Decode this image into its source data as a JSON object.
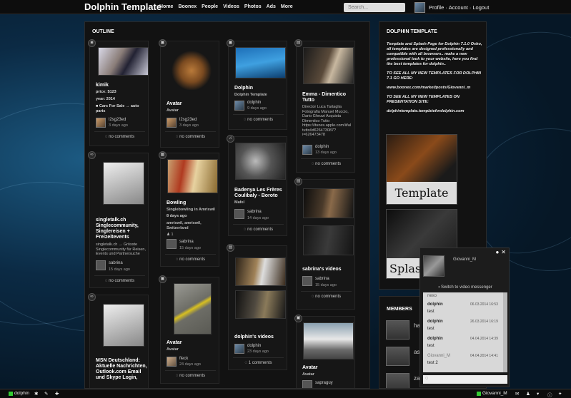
{
  "header": {
    "logo": "Dolphin Template",
    "nav": [
      "Home",
      "Boonex",
      "People",
      "Videos",
      "Photos",
      "Ads",
      "More"
    ],
    "search_placeholder": "Search...",
    "user_menu": [
      "Profile",
      "·",
      "Account",
      "·",
      "Logout"
    ]
  },
  "outline": {
    "title": "OUTLINE",
    "col1": [
      {
        "icon": "camera-icon",
        "title": "kimik",
        "price": "price: $123",
        "year": "year: 2014",
        "category": "Cars For Sale → auto parts",
        "user": "l2sg23ed",
        "date": "3 days ago",
        "comments": "no comments"
      },
      {
        "icon": "link-icon",
        "title": "singletalk.ch Singlecommunity, Singlereisen + Freizeitevents",
        "desc": "singletalk.ch → Grösste Singlecommunity für Reisen, Events und Partnersuche",
        "user": "sabrina",
        "date": "15 days ago",
        "comments": "no comments"
      },
      {
        "icon": "link-icon",
        "title": "MSN Deutschland: Aktuelle Nachrichten, Outlook.com Email und Skype Login,",
        "user": "",
        "date": "",
        "comments": ""
      }
    ],
    "col2": [
      {
        "icon": "image-icon",
        "title": "Avatar",
        "sub": "Avatar",
        "user": "l2sg23ed",
        "date": "3 days ago",
        "comments": "no comments"
      },
      {
        "icon": "calendar-icon",
        "title": "Bowling",
        "sub": "Singlebowling in Amriswil",
        "when": "8 days ago",
        "place": "amriswil, amriswil, Switzerland",
        "count": "1",
        "user": "sabrina",
        "date": "15 days ago",
        "comments": "no comments"
      },
      {
        "icon": "image-icon",
        "title": "Avatar",
        "sub": "Avatar",
        "user": "fleck",
        "date": "24 days ago",
        "comments": "no comments"
      }
    ],
    "col3": [
      {
        "icon": "image-icon",
        "title": "Dolphin",
        "sub": "Dolphin Template",
        "user": "dolphin",
        "date": "9 days ago",
        "comments": "no comments"
      },
      {
        "icon": "music-icon",
        "title": "Badenya Les Frères Coulibaly - Boroto",
        "sub": "Mafel",
        "user": "sabrina",
        "date": "14 days ago",
        "comments": "no comments"
      },
      {
        "icon": "film-icon",
        "title": "dolphin's videos",
        "user": "dolphin",
        "date": "23 days ago",
        "comments": "1 comments"
      }
    ],
    "col4": [
      {
        "icon": "film-icon",
        "title": "Emma - Dimentico Tutto",
        "desc": "Director Luca Tartaglia Fotografia Manuel Muccio, Dario Ghezzi Acquista Dimentico Tutto https://itunes.apple.com/it/al tutto/id626473087? i=626473478",
        "user": "dolphin",
        "date": "13 days ago",
        "comments": "no comments"
      },
      {
        "icon": "film-icon",
        "title": "sabrina's videos",
        "user": "sabrina",
        "date": "15 days ago",
        "comments": "no comments"
      },
      {
        "icon": "image-icon",
        "title": "Avatar",
        "sub": "Avatar",
        "user": "sapraguy",
        "date": "",
        "comments": ""
      }
    ]
  },
  "right": {
    "title": "DOLPHIN TEMPLATE",
    "text1": "Template and Splash Page for Dolphin 7.1.0 Osho, all templates are designed professionally and compatible with all browsers.. make a new professional look to your website, here you find the best templates for dolphin..",
    "text2": "TO SEE ALL MY NEW TEMPLATES FOR DOLPHIN 7.1 GO HERE:",
    "link1": "www.boonex.com/market/posts/Giovanni_m",
    "text3": "TO SEE ALL MY NEW TEMPLATES ON PRESENTATION SITE:",
    "link2": "dolphintemplate.templatefordolphin.com",
    "img_label1": "Template",
    "img_label2": "Splas",
    "members_title": "MEMBERS",
    "member_names": [
      "ha",
      "asl",
      "zai"
    ]
  },
  "chat": {
    "user": "Giovanni_M",
    "switch": "Switch to video messenger",
    "messages": [
      {
        "name": "nexo",
        "date": "",
        "text": ""
      },
      {
        "name": "dolphin",
        "date": "06.03.2014 16:53",
        "text": "test"
      },
      {
        "name": "dolphin",
        "date": "26.03.2014 16:19",
        "text": "test"
      },
      {
        "name": "dolphin",
        "date": "04.04.2014 14:39",
        "text": "test"
      },
      {
        "name": "Giovanni_M",
        "date": "04.04.2014 14:41",
        "text": "test 2"
      }
    ]
  },
  "bottombar": {
    "left_user": "dolphin",
    "right_user": "Giovanni_M"
  },
  "colors": {
    "bg": "#0b2a44",
    "online": "#33cc33",
    "accent": "#ffffff"
  }
}
